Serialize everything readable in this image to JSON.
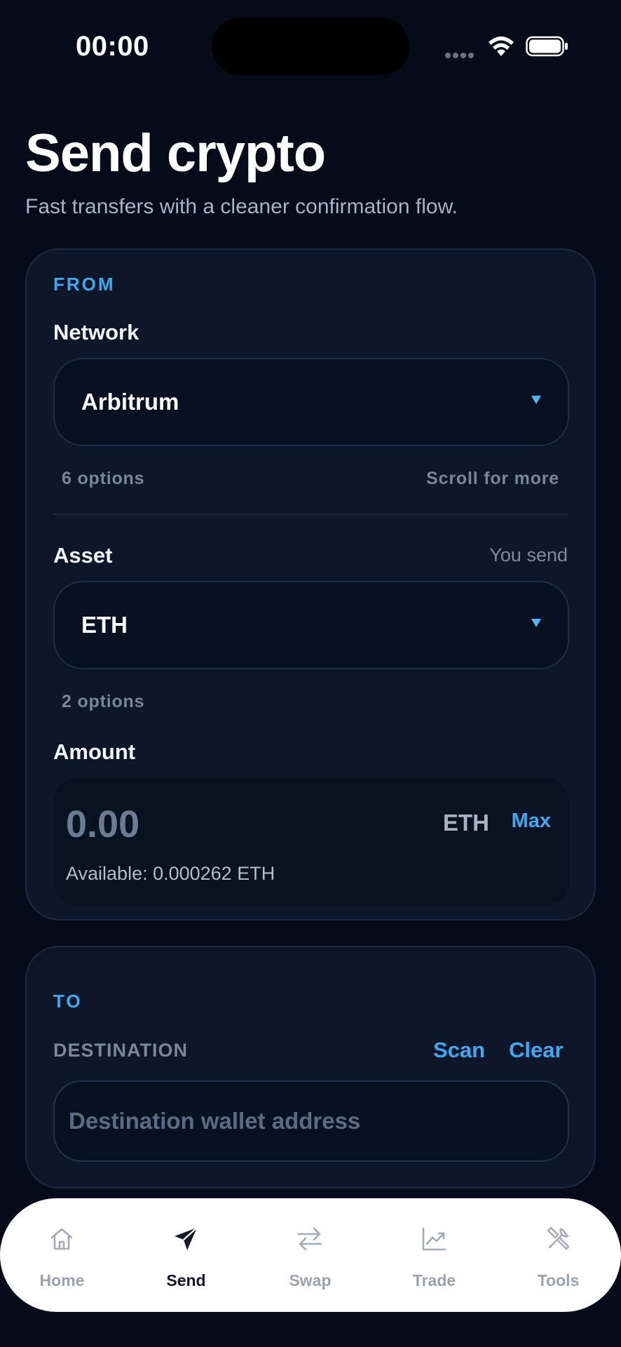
{
  "status_bar": {
    "time": "00:00"
  },
  "header": {
    "title": "Send crypto",
    "subtitle": "Fast transfers with a cleaner confirmation flow."
  },
  "from": {
    "section_label": "FROM",
    "network": {
      "label": "Network",
      "selected": "Arbitrum",
      "options_count": "6 options",
      "scroll_hint": "Scroll for more"
    },
    "asset": {
      "label": "Asset",
      "side_note": "You send",
      "selected": "ETH",
      "options_count": "2 options"
    },
    "amount": {
      "label": "Amount",
      "value": "0.00",
      "unit": "ETH",
      "max_label": "Max",
      "available": "Available: 0.000262 ETH"
    }
  },
  "to": {
    "section_label": "TO",
    "destination_label": "DESTINATION",
    "scan_label": "Scan",
    "clear_label": "Clear",
    "placeholder": "Destination wallet address"
  },
  "tabs": [
    {
      "label": "Home",
      "icon": "home-icon",
      "active": false
    },
    {
      "label": "Send",
      "icon": "send-icon",
      "active": true
    },
    {
      "label": "Swap",
      "icon": "swap-icon",
      "active": false
    },
    {
      "label": "Trade",
      "icon": "trade-icon",
      "active": false
    },
    {
      "label": "Tools",
      "icon": "tools-icon",
      "active": false
    }
  ],
  "colors": {
    "background": "#050b18",
    "card": "#0e1729",
    "accent": "#3ea8f0",
    "tab_bar": "#ffffff"
  }
}
